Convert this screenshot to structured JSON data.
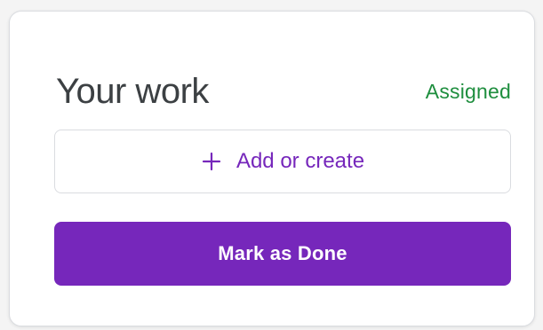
{
  "card": {
    "title": "Your work",
    "status": "Assigned"
  },
  "actions": {
    "add_label": "Add or create",
    "add_icon": "plus-icon",
    "done_label": "Mark as Done"
  },
  "colors": {
    "accent": "#7627bb",
    "status_green": "#1e8e3e",
    "title_text": "#3c4043",
    "border": "#dadce0"
  }
}
